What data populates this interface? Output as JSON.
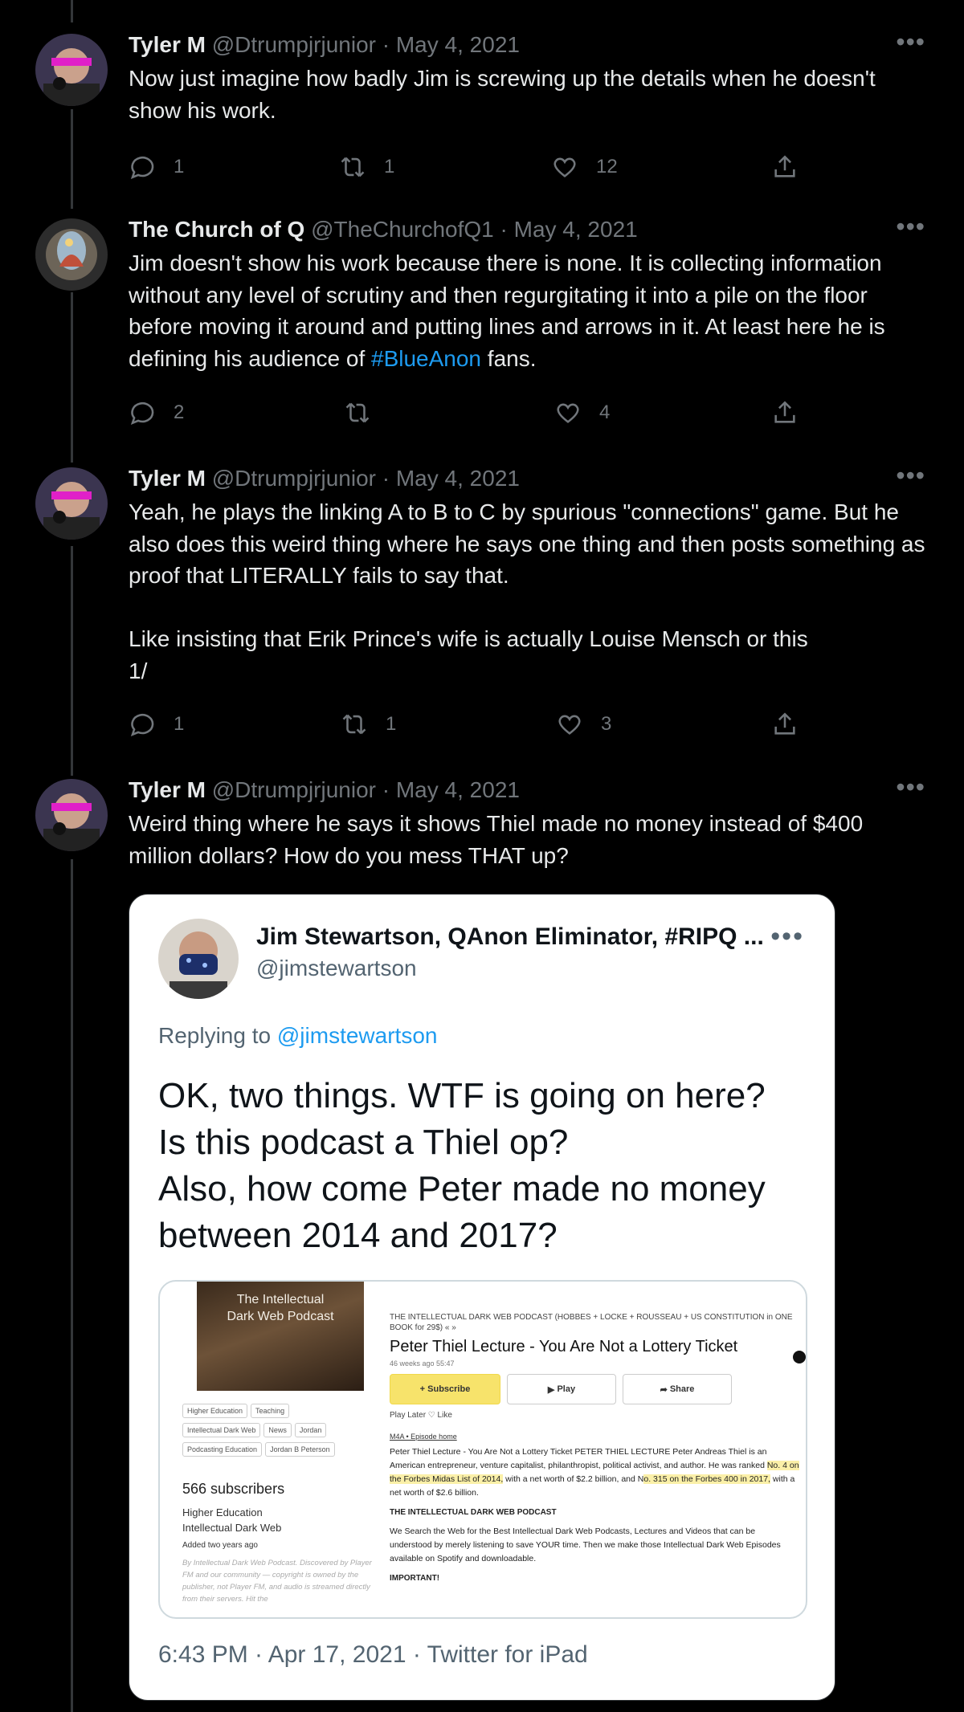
{
  "tweets": [
    {
      "name": "Tyler M",
      "meta": "@Dtrumpjrjunior · May 4, 2021",
      "text": "Now just imagine how badly Jim is screwing up the details when he doesn't show his work.",
      "replies": "1",
      "retweets": "1",
      "likes": "12"
    },
    {
      "name": "The Church of Q",
      "meta": "@TheChurchofQ1 · May 4, 2021",
      "text_before": "Jim doesn't show his work because there is none. It is collecting information without any level of scrutiny and then regurgitating it into a pile on the floor before moving it around and putting lines and arrows in it. At least here he is defining his audience of ",
      "hashtag": "#BlueAnon",
      "text_after": " fans.",
      "replies": "2",
      "retweets": "",
      "likes": "4"
    },
    {
      "name": "Tyler M",
      "meta": "@Dtrumpjrjunior · May 4, 2021",
      "text": "Yeah, he plays the linking A to B to C by spurious \"connections\" game. But he also does this weird thing where he says one thing and then posts something as proof that LITERALLY fails to say that.\n\nLike insisting that Erik Prince's wife is actually Louise Mensch or this\n1/",
      "replies": "1",
      "retweets": "1",
      "likes": "3"
    },
    {
      "name": "Tyler M",
      "meta": "@Dtrumpjrjunior · May 4, 2021",
      "text": "Weird thing where he says it shows Thiel made no money instead of $400 million dollars? How do you mess THAT up?"
    }
  ],
  "embed": {
    "name": "Jim Stewartson, QAnon Eliminator, #RIPQ ...",
    "handle": "@jimstewartson",
    "replying_prefix": "Replying to ",
    "replying_mention": "@jimstewartson",
    "text": "OK, two things. WTF is going on here?\nIs this podcast a Thiel op?\nAlso, how come Peter made no money between 2014 and 2017?",
    "timestamp": "6:43 PM · Apr 17, 2021 · Twitter for iPad",
    "screenshot": {
      "portrait_title": "The Intellectual\nDark Web Podcast",
      "tags_row1": [
        "Higher Education",
        "Teaching"
      ],
      "tags_row2": [
        "Intellectual Dark Web",
        "News",
        "Jordan"
      ],
      "tags_row3": [
        "Podcasting Education",
        "Jordan B Peterson"
      ],
      "subscribers": "566 subscribers",
      "cat1": "Higher Education",
      "cat2": "Intellectual Dark Web",
      "added": "Added two years ago",
      "fine_print": "By Intellectual Dark Web Podcast. Discovered by Player FM and our community — copyright is owned by the publisher, not Player FM, and audio is streamed directly from their servers. Hit the",
      "podcast_line": "THE INTELLECTUAL DARK WEB PODCAST (HOBBES + LOCKE + ROUSSEAU + US CONSTITUTION in ONE BOOK for 29$) « »",
      "episode_title": "Peter Thiel Lecture - You Are Not a Lottery Ticket",
      "ago": "46 weeks ago 55:47",
      "subscribe": "+ Subscribe",
      "play": "Play",
      "share": "Share",
      "play_later": "Play Later   ♡ Like",
      "crumbs": "M4A • Episode home",
      "desc_a": "Peter Thiel Lecture - You Are Not a Lottery Ticket PETER THIEL LECTURE Peter Andreas Thiel is an American entrepreneur, venture capitalist, philanthropist, political activist, and author. He was ranked ",
      "desc_hl1": "No. 4 on the Forbes Midas List of 2014,",
      "desc_b": " with a net worth of $2.2 billion, and N",
      "desc_hl2": "o. 315 on the Forbes 400 in 2017,",
      "desc_c": " with a net worth of $2.6 billion.",
      "section": "THE INTELLECTUAL DARK WEB PODCAST",
      "desc2": "We Search the Web for the Best Intellectual Dark Web Podcasts, Lectures and Videos that can be understood by merely listening to save YOUR time. Then we make those Intellectual Dark Web Episodes available on Spotify and downloadable.",
      "important": "IMPORTANT!"
    }
  },
  "icons": [
    "reply-icon",
    "retweet-icon",
    "like-icon",
    "share-icon",
    "more-icon"
  ],
  "colors": {
    "background": "#000000",
    "text": "#e7e9ea",
    "muted": "#71767b",
    "link": "#1d9bf0"
  }
}
